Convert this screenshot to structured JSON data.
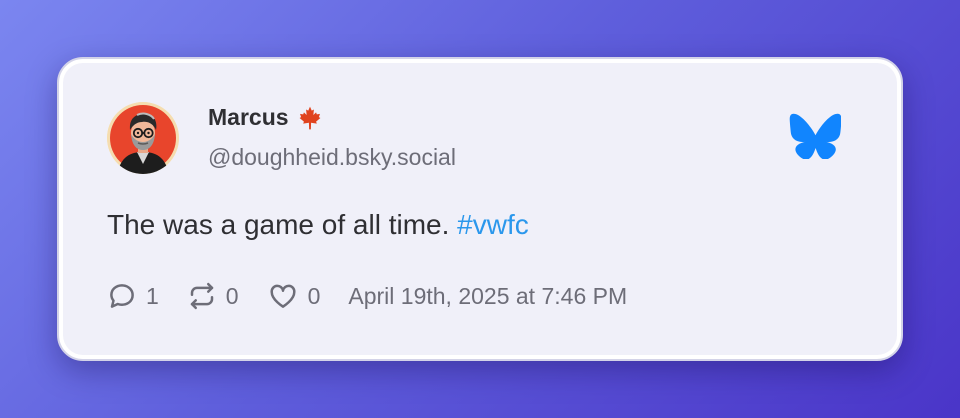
{
  "post": {
    "author": {
      "display_name": "Marcus",
      "flag_emoji": "🍁",
      "handle": "@doughheid.bsky.social"
    },
    "text": "The was a game of all time.",
    "hashtag": "#vwfc",
    "stats": {
      "replies": "1",
      "reposts": "0",
      "likes": "0"
    },
    "timestamp": "April 19th, 2025 at 7:46 PM"
  },
  "icons": {
    "reply": "reply-icon",
    "repost": "repost-icon",
    "like": "heart-icon",
    "brand": "bluesky-butterfly-icon",
    "flag": "maple-leaf-icon"
  },
  "colors": {
    "background_start": "#7b86f0",
    "background_end": "#4a35c8",
    "card": "#f0f0f9",
    "text": "#2f2f33",
    "muted": "#6d6d78",
    "link": "#2a97ec",
    "bluesky": "#1185fe",
    "maple": "#e0431f"
  }
}
